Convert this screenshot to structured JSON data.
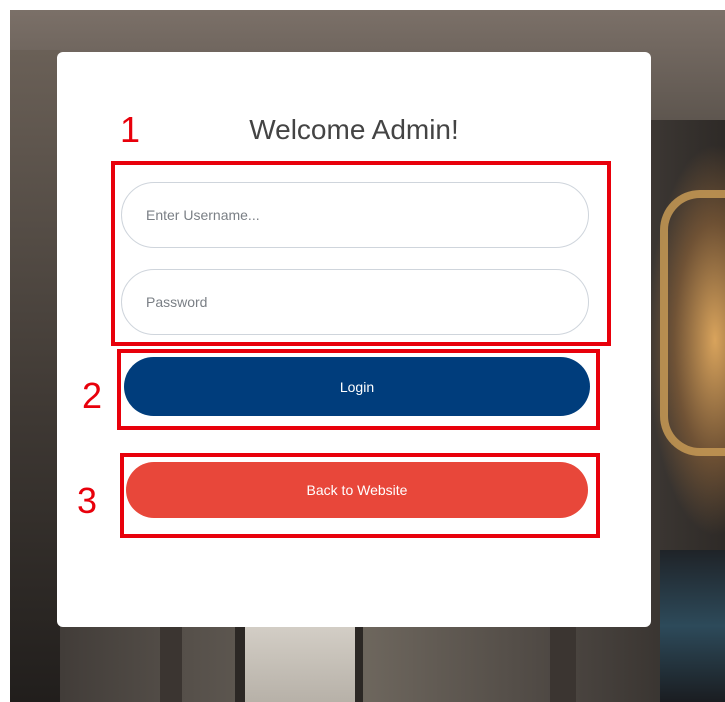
{
  "login_card": {
    "title": "Welcome Admin!",
    "username_placeholder": "Enter Username...",
    "password_placeholder": "Password",
    "login_label": "Login",
    "back_label": "Back to Website"
  },
  "annotations": {
    "labels": [
      "1",
      "2",
      "3"
    ],
    "color": "#e8000b"
  },
  "colors": {
    "login_button": "#003d7c",
    "back_button": "#e8473a",
    "card": "#ffffff"
  }
}
